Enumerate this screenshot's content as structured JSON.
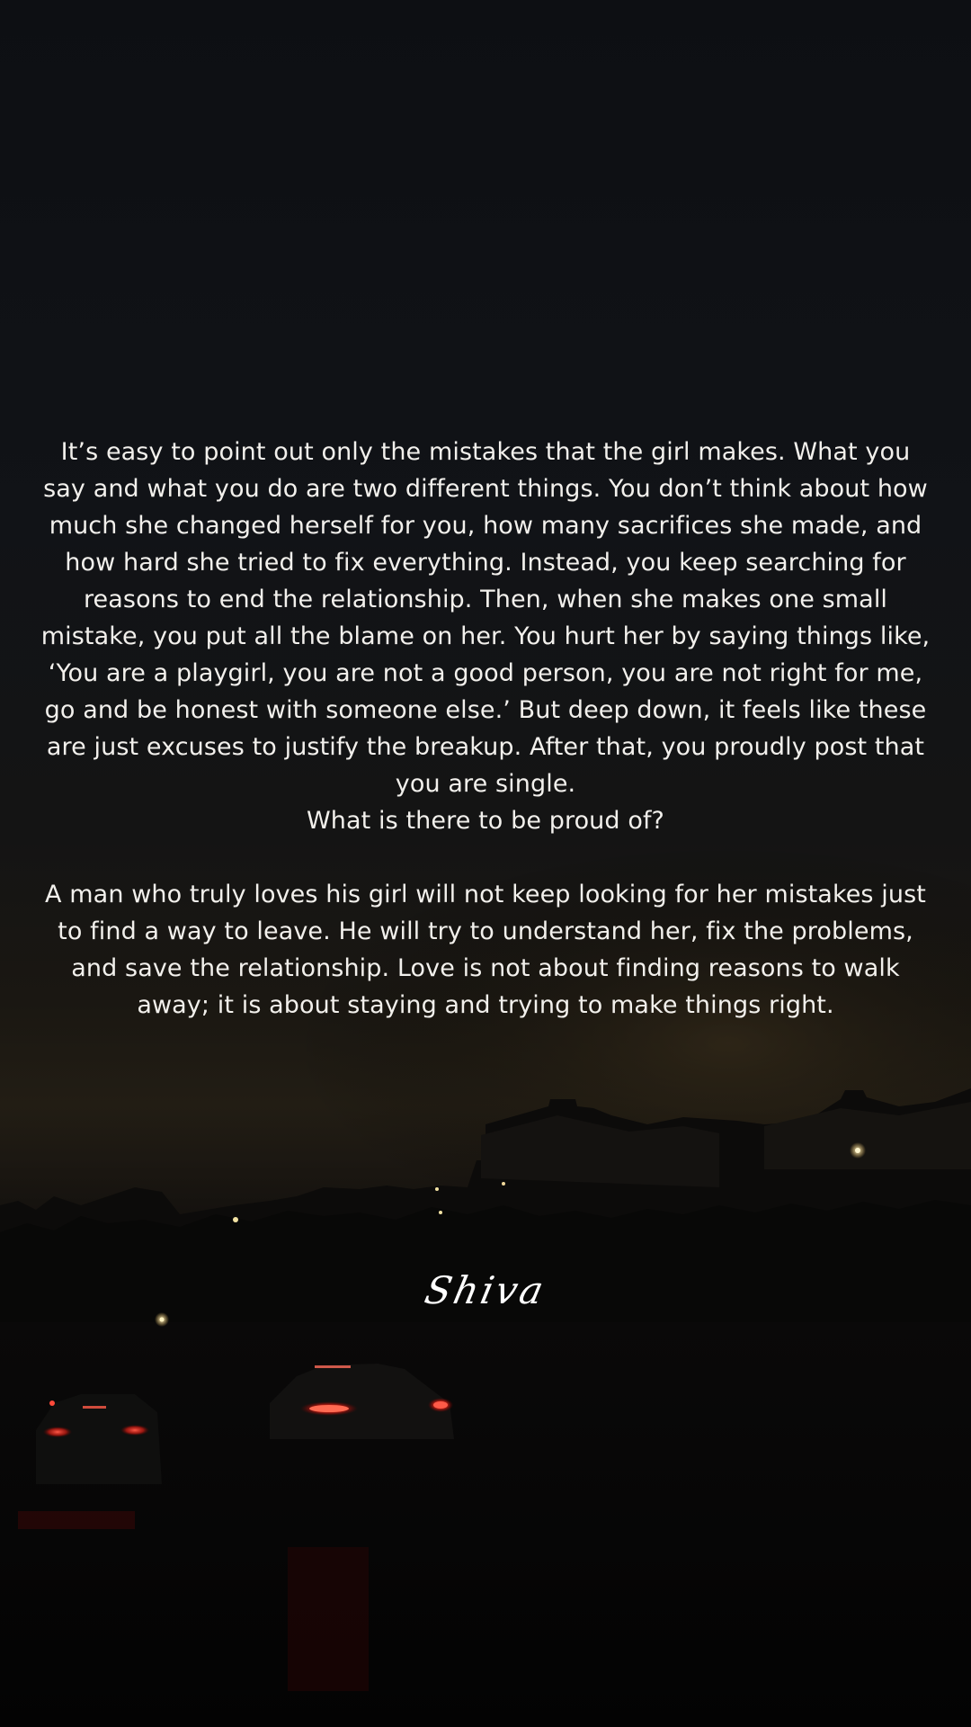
{
  "scene": {
    "description_colors": {
      "sky": "#111317",
      "horizon_glow": "#2a2216",
      "ground": "#050505",
      "tail_light": "#ff3b2f",
      "street_light": "#f5e9b0",
      "text": "#f2f0ec"
    }
  },
  "quote": {
    "paragraph_1": "It’s easy to point out only the mistakes that the girl makes. What you say and what you do are two different things. You don’t think about how much she changed herself for you, how many sacrifices she made, and how hard she tried to fix everything. Instead, you keep searching for reasons to end the relationship. Then, when she makes one small mistake, you put all the blame on her. You hurt her by saying things like, ‘You are a playgirl, you are not a good person, you are not right for me, go and be honest with someone else.’ But deep down, it feels like these are just excuses to justify the breakup. After that, you proudly post that you are single.",
    "question": "What is there to be proud of?",
    "paragraph_2": "A man who truly loves his girl will not keep looking for her mistakes just to find a way to leave. He will try to understand her, fix the problems, and save the relationship. Love is not about finding reasons to walk away; it is about staying and trying to make things right."
  },
  "signature": "Shiva"
}
